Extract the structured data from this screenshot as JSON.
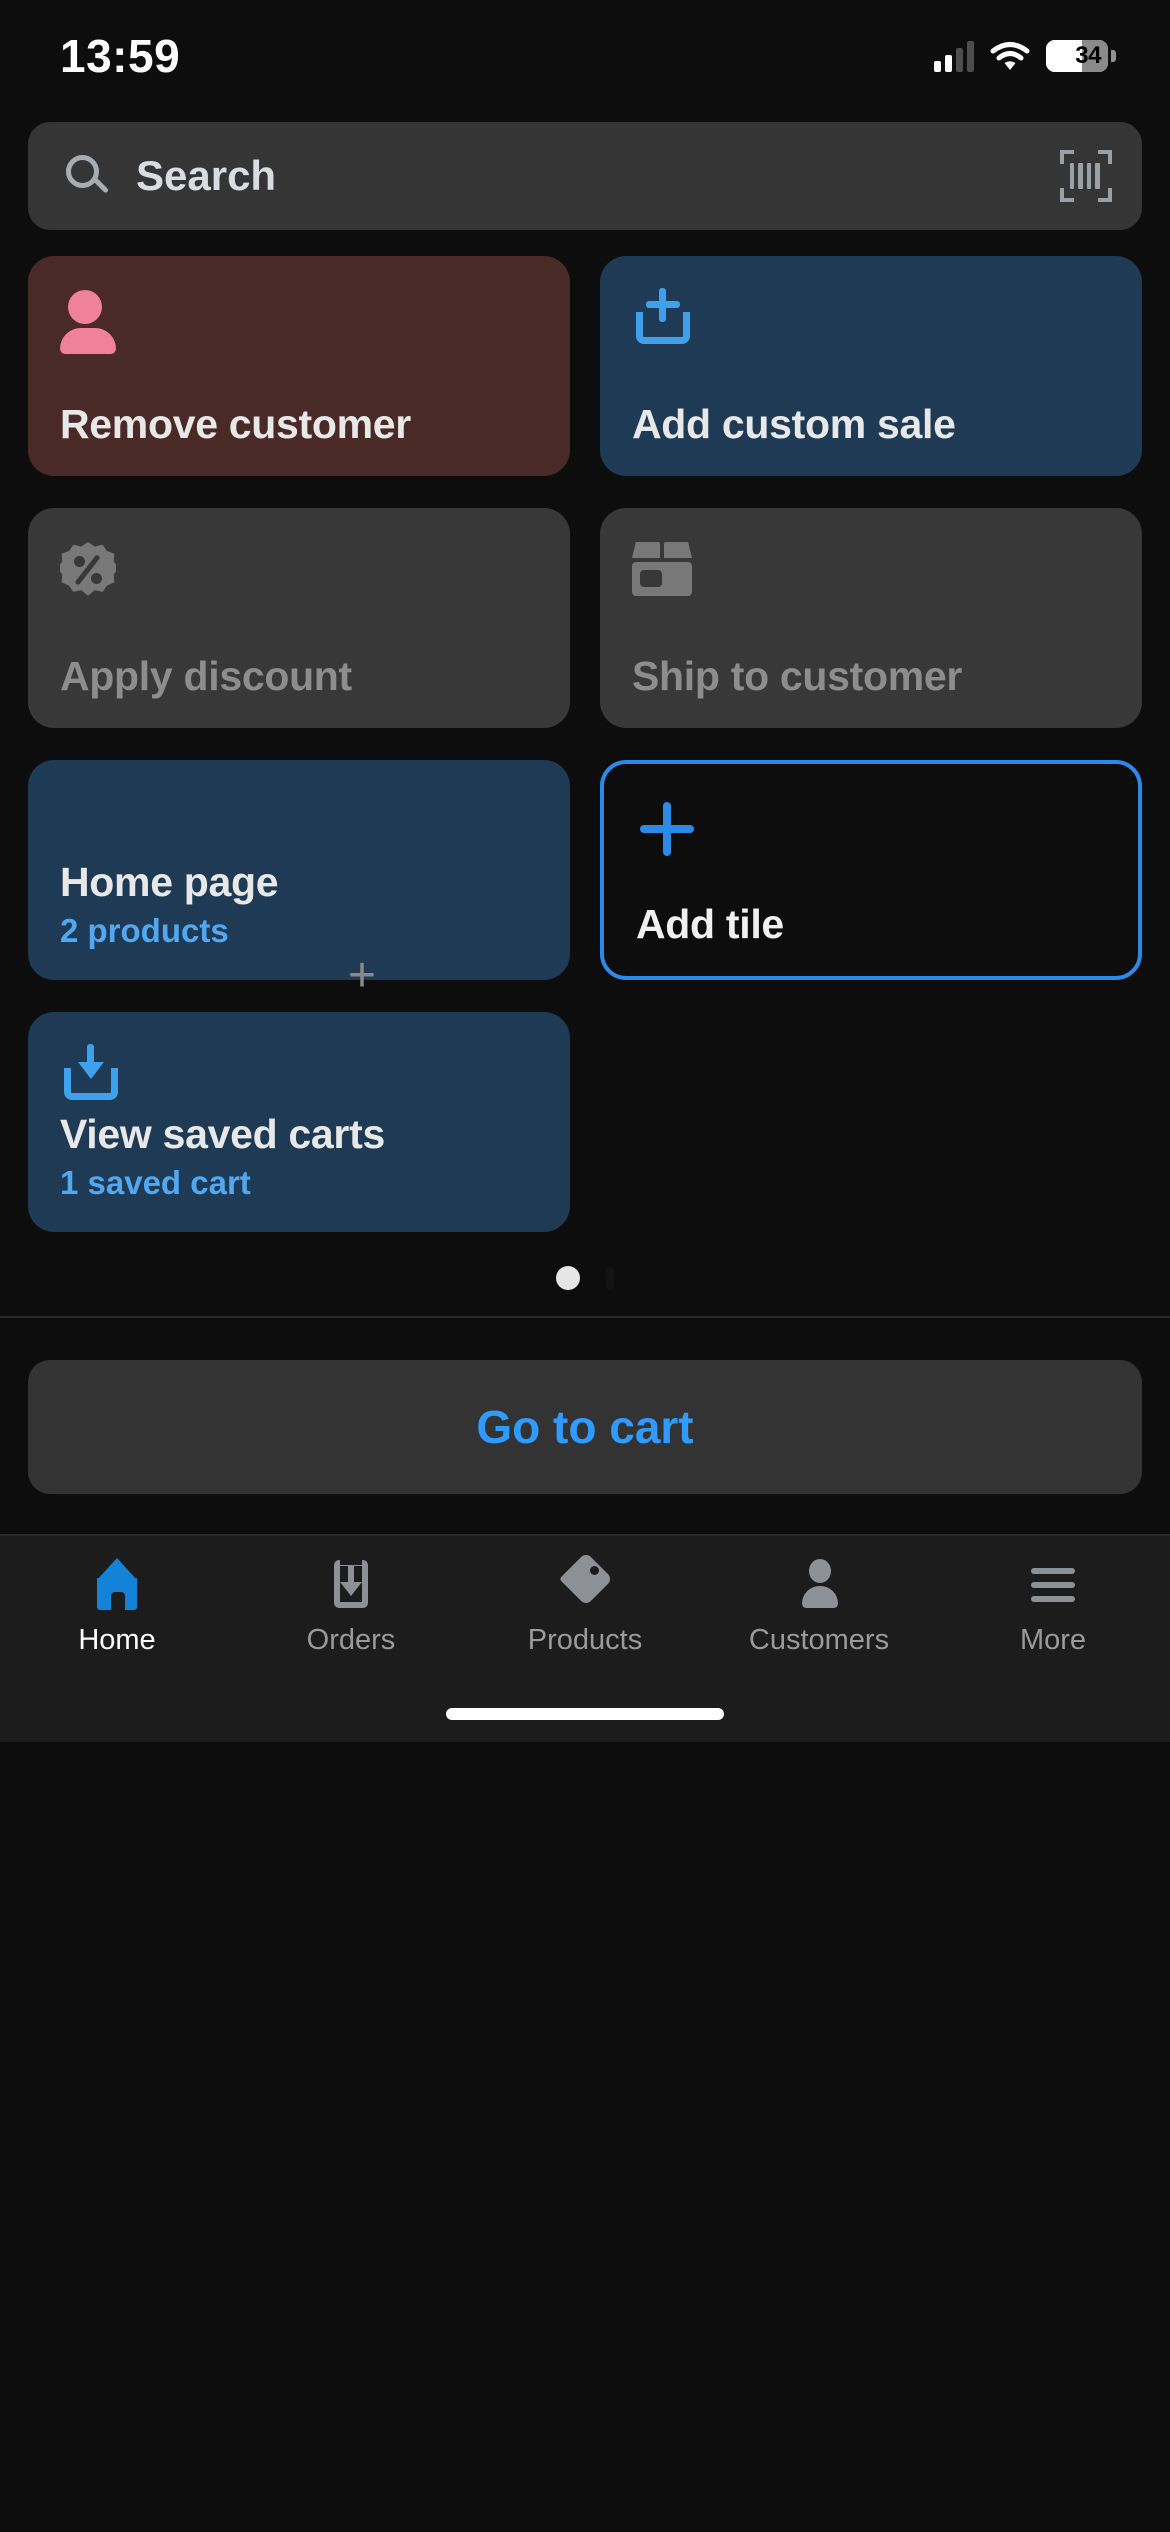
{
  "status_bar": {
    "time": "13:59",
    "battery_level": "34",
    "signal_icon": "cellular-signal-icon",
    "wifi_icon": "wifi-icon",
    "battery_icon": "battery-icon"
  },
  "search": {
    "placeholder": "Search",
    "search_icon": "search-icon",
    "scanner_icon": "barcode-scanner-icon"
  },
  "tiles": [
    {
      "label": "Remove customer",
      "sub": "",
      "icon": "person-icon",
      "style": "solid-red",
      "enabled": true
    },
    {
      "label": "Add custom sale",
      "sub": "",
      "icon": "add-to-tray-icon",
      "style": "solid-blue",
      "enabled": true
    },
    {
      "label": "Apply discount",
      "sub": "",
      "icon": "percent-badge-icon",
      "style": "disabled",
      "enabled": false
    },
    {
      "label": "Ship to customer",
      "sub": "",
      "icon": "package-box-icon",
      "style": "disabled",
      "enabled": false
    },
    {
      "label": "Home page",
      "sub": "2 products",
      "icon": "",
      "style": "solid-blue",
      "enabled": true
    },
    {
      "label": "Add tile",
      "sub": "",
      "icon": "plus-icon",
      "style": "outline",
      "enabled": true
    },
    {
      "label": "View saved carts",
      "sub": "1 saved cart",
      "icon": "download-tray-icon",
      "style": "solid-blue",
      "enabled": true
    }
  ],
  "drag_handle": {
    "glyph": "+"
  },
  "pagination": {
    "total": 2,
    "active_index": 0
  },
  "cart": {
    "label": "Go to cart"
  },
  "bottom_nav": {
    "items": [
      {
        "label": "Home",
        "icon": "home-icon",
        "active": true
      },
      {
        "label": "Orders",
        "icon": "orders-box-icon",
        "active": false
      },
      {
        "label": "Products",
        "icon": "tag-icon",
        "active": false
      },
      {
        "label": "Customers",
        "icon": "person-icon",
        "active": false
      },
      {
        "label": "More",
        "icon": "hamburger-menu-icon",
        "active": false
      }
    ]
  },
  "colors": {
    "background": "#0d0d0d",
    "accent_blue": "#2f9bff",
    "tile_blue": "#1e3a54",
    "tile_red": "#4a2a26",
    "tile_disabled": "#383838",
    "pink_icon": "#f0819b",
    "outline_blue": "#2b8ae6"
  }
}
